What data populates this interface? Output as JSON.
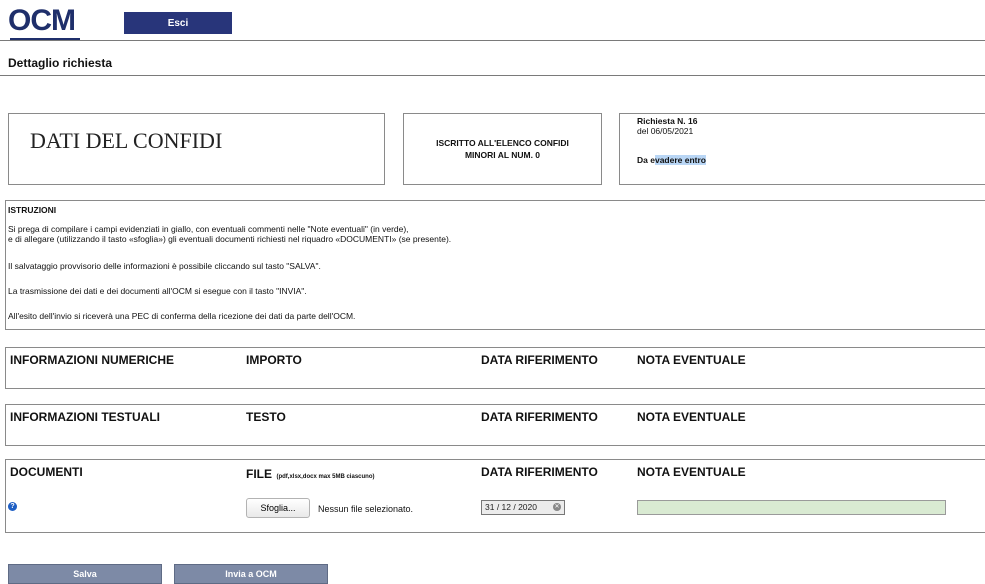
{
  "header": {
    "logo_text": "OCM",
    "exit_label": "Esci",
    "page_title": "Dettaglio richiesta"
  },
  "info": {
    "confidi_title": "DATI DEL CONFIDI",
    "registry_line1": "ISCRITTO ALL'ELENCO CONFIDI",
    "registry_line2": "MINORI AL NUM.  0",
    "request_number": "Richiesta N. 16",
    "request_date": "del 06/05/2021",
    "due_prefix": "Da e",
    "due_highlight": "vadere entro"
  },
  "instructions": {
    "title": "ISTRUZIONI",
    "lines": [
      "Si prega di compilare i campi evidenziati in giallo, con eventuali commenti nelle \"Note eventuali\" (in verde),",
      "e di allegare (utilizzando il tasto «sfoglia») gli eventuali documenti richiesti nel riquadro «DOCUMENTI» (se presente).",
      "Il salvataggio provvisorio delle informazioni è possibile cliccando sul tasto \"SALVA\".",
      "La trasmissione dei dati e dei documenti all'OCM si esegue con il tasto \"INVIA\".",
      "All'esito dell'invio si riceverà una PEC di conferma della ricezione dei dati da parte dell'OCM."
    ]
  },
  "sections": {
    "numeric": {
      "title": "INFORMAZIONI NUMERICHE",
      "col2": "IMPORTO",
      "col3": "DATA RIFERIMENTO",
      "col4": "NOTA EVENTUALE"
    },
    "textual": {
      "title": "INFORMAZIONI TESTUALI",
      "col2": "TESTO",
      "col3": "DATA RIFERIMENTO",
      "col4": "NOTA EVENTUALE"
    },
    "documents": {
      "title": "DOCUMENTI",
      "col2": "FILE",
      "col2_note": "(pdf,xlsx,docx max 5MB ciascuno)",
      "col3": "DATA RIFERIMENTO",
      "col4": "NOTA EVENTUALE",
      "browse_label": "Sfoglia...",
      "no_file_label": "Nessun file selezionato.",
      "date_value": "31 / 12 / 2020",
      "help_symbol": "?"
    }
  },
  "actions": {
    "save_label": "Salva",
    "send_label": "Invia a OCM"
  }
}
